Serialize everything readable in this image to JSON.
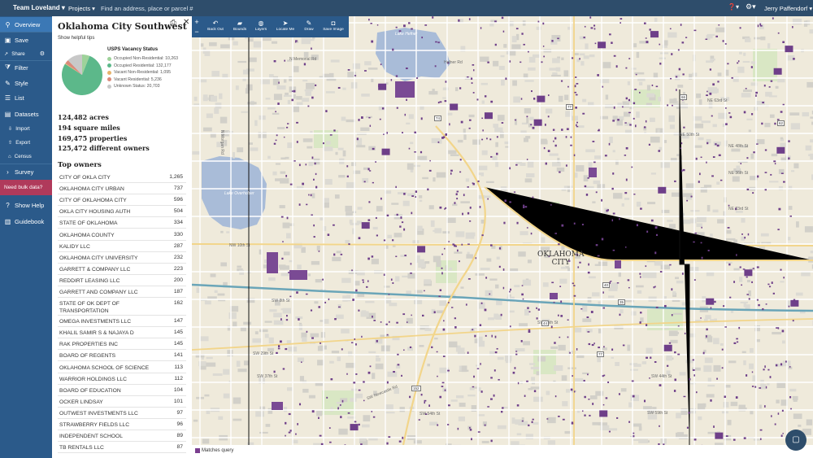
{
  "topbar": {
    "team": "Team Loveland",
    "projects": "Projects",
    "address_placeholder": "Find an address, place or parcel #",
    "user": "Jerry Paffendorf"
  },
  "sidebar": {
    "overview": "Overview",
    "save": "Save",
    "share": "Share",
    "filter": "Filter",
    "style": "Style",
    "list": "List",
    "datasets": "Datasets",
    "import": "Import",
    "export": "Export",
    "census": "Census",
    "survey": "Survey",
    "bulk": "Need bulk data?",
    "show_help": "Show Help",
    "guidebook": "Guidebook"
  },
  "panel": {
    "title": "Oklahoma City Southwest",
    "tips": "Show helpful tips",
    "legend_title": "USPS Vacancy Status",
    "legend": [
      {
        "label": "Occupied Non-Residential: 10,263",
        "value": 10263,
        "color": "#9ed29a"
      },
      {
        "label": "Occupied Residential: 132,177",
        "value": 132177,
        "color": "#5cb88a"
      },
      {
        "label": "Vacant Non-Residential: 1,095",
        "value": 1095,
        "color": "#e7b36b"
      },
      {
        "label": "Vacant Residential: 5,236",
        "value": 5236,
        "color": "#d98a7a"
      },
      {
        "label": "Unknown Status: 20,703",
        "value": 20703,
        "color": "#c8c8c8"
      }
    ],
    "stats": {
      "acres": "124,482 acres",
      "miles": "194 square miles",
      "properties": "169,475 properties",
      "owners": "125,472 different owners"
    },
    "top_owners_title": "Top owners",
    "owners": [
      {
        "name": "CITY OF OKLA CITY",
        "count": "1,265"
      },
      {
        "name": "OKLAHOMA CITY URBAN",
        "count": "737"
      },
      {
        "name": "CITY OF OKLAHOMA CITY",
        "count": "596"
      },
      {
        "name": "OKLA CITY HOUSING AUTH",
        "count": "504"
      },
      {
        "name": "STATE OF OKLAHOMA",
        "count": "334"
      },
      {
        "name": "OKLAHOMA COUNTY",
        "count": "330"
      },
      {
        "name": "KALIDY LLC",
        "count": "287"
      },
      {
        "name": "OKLAHOMA CITY UNIVERSITY",
        "count": "232"
      },
      {
        "name": "GARRETT & COMPANY LLC",
        "count": "223"
      },
      {
        "name": "REDDIRT LEASING LLC",
        "count": "200"
      },
      {
        "name": "GARRETT AND COMPANY LLC",
        "count": "187"
      },
      {
        "name": "STATE OF OK DEPT OF TRANSPORTATION",
        "count": "162"
      },
      {
        "name": "OMEGA INVESTMENTS LLC",
        "count": "147"
      },
      {
        "name": "KHALIL SAMIR S & NAJAYA D",
        "count": "145"
      },
      {
        "name": "RAK PROPERTIES INC",
        "count": "145"
      },
      {
        "name": "BOARD OF REGENTS",
        "count": "141"
      },
      {
        "name": "OKLAHOMA SCHOOL OF SCIENCE",
        "count": "113"
      },
      {
        "name": "WARRIOR HOLDINGS LLC",
        "count": "112"
      },
      {
        "name": "BOARD OF EDUCATION",
        "count": "104"
      },
      {
        "name": "OCKER LINDSAY",
        "count": "101"
      },
      {
        "name": "OUTWEST INVESTMENTS LLC",
        "count": "97"
      },
      {
        "name": "STRAWBERRY FIELDS LLC",
        "count": "96"
      },
      {
        "name": "INDEPENDENT SCHOOL",
        "count": "89"
      },
      {
        "name": "TB RENTALS LLC",
        "count": "87"
      }
    ]
  },
  "map_tools": {
    "back_out": "Back Out",
    "bounds": "Bounds",
    "layers": "Layers",
    "locate": "Locate Me",
    "draw": "Draw",
    "save_image": "Save Image"
  },
  "map": {
    "city_line1": "OKLAHOMA",
    "city_line2": "CITY",
    "lake_hefner": "Lake Hefner",
    "lake_overholser": "Lake Overholser",
    "streets": {
      "nw10": "NW 10th St",
      "sw8": "SW 8th St",
      "sw29": "SW 29th St",
      "sw37": "SW 37th St",
      "sw44": "SW 44th St",
      "sw54": "SW 54th St",
      "sw59": "SW 59th St",
      "ne63": "NE 63rd St",
      "ne50": "NE 50th St",
      "ne48": "NE 48th St",
      "ne36": "NE 36th St",
      "ne23": "NE 23rd St",
      "newcastle": "SW Newcastle Rd",
      "sw15": "SW 15th St",
      "hefner": "Hefner Rd",
      "morgan": "N Morgan Rd",
      "memorial": "N Memorial Rd"
    },
    "highways": [
      "74",
      "77",
      "66",
      "62",
      "40",
      "35",
      "44",
      "152",
      "77"
    ]
  },
  "legend_bottom": "Matches query"
}
